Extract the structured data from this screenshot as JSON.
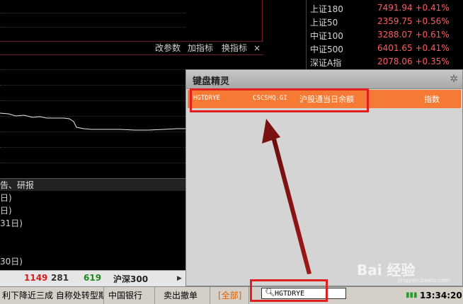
{
  "indicator_bar": {
    "change_params": "改参数",
    "add_indicator": "加指标",
    "switch_indicator": "换指标",
    "close": "×"
  },
  "quotes": [
    {
      "name": "上证180",
      "value": "7491.94 +0.41%"
    },
    {
      "name": "上证50",
      "value": "2359.75 +0.56%"
    },
    {
      "name": "中证100",
      "value": "3288.07 +0.61%"
    },
    {
      "name": "中证500",
      "value": "6401.65 +0.41%"
    },
    {
      "name": "深证A指",
      "value": "2078.06 +0.35%"
    }
  ],
  "news": {
    "header": "告、研报",
    "items": [
      "日)",
      "日)",
      "31日)",
      "",
      "",
      "30日)"
    ]
  },
  "counters": {
    "c1": "1149",
    "c2": "281",
    "c3": "619",
    "market": "沪深300"
  },
  "status_bar": {
    "ticker_text": "利下降近三成 自称处转型期",
    "stock": "中国银行",
    "order": "卖出撤单",
    "all": "[全部]",
    "time": "13:34:20"
  },
  "wizard": {
    "title": "键盘精灵",
    "result": {
      "code": "HGTDRYE",
      "symbol": "CSCSHQ.GI",
      "name": "沪股通当日余额",
      "type": "指数"
    }
  },
  "search": {
    "value": "HGTDRYE"
  },
  "watermark": {
    "text": "Bai 经验",
    "sub": "jingyan.baidu.com"
  },
  "icons": {
    "gear": "gear-icon",
    "search": "search-icon",
    "signal": "signal-bars-icon"
  },
  "colors": {
    "up_red": "#ff5b5b",
    "highlight_orange": "#f57a33",
    "annotation_red": "#e02020"
  }
}
